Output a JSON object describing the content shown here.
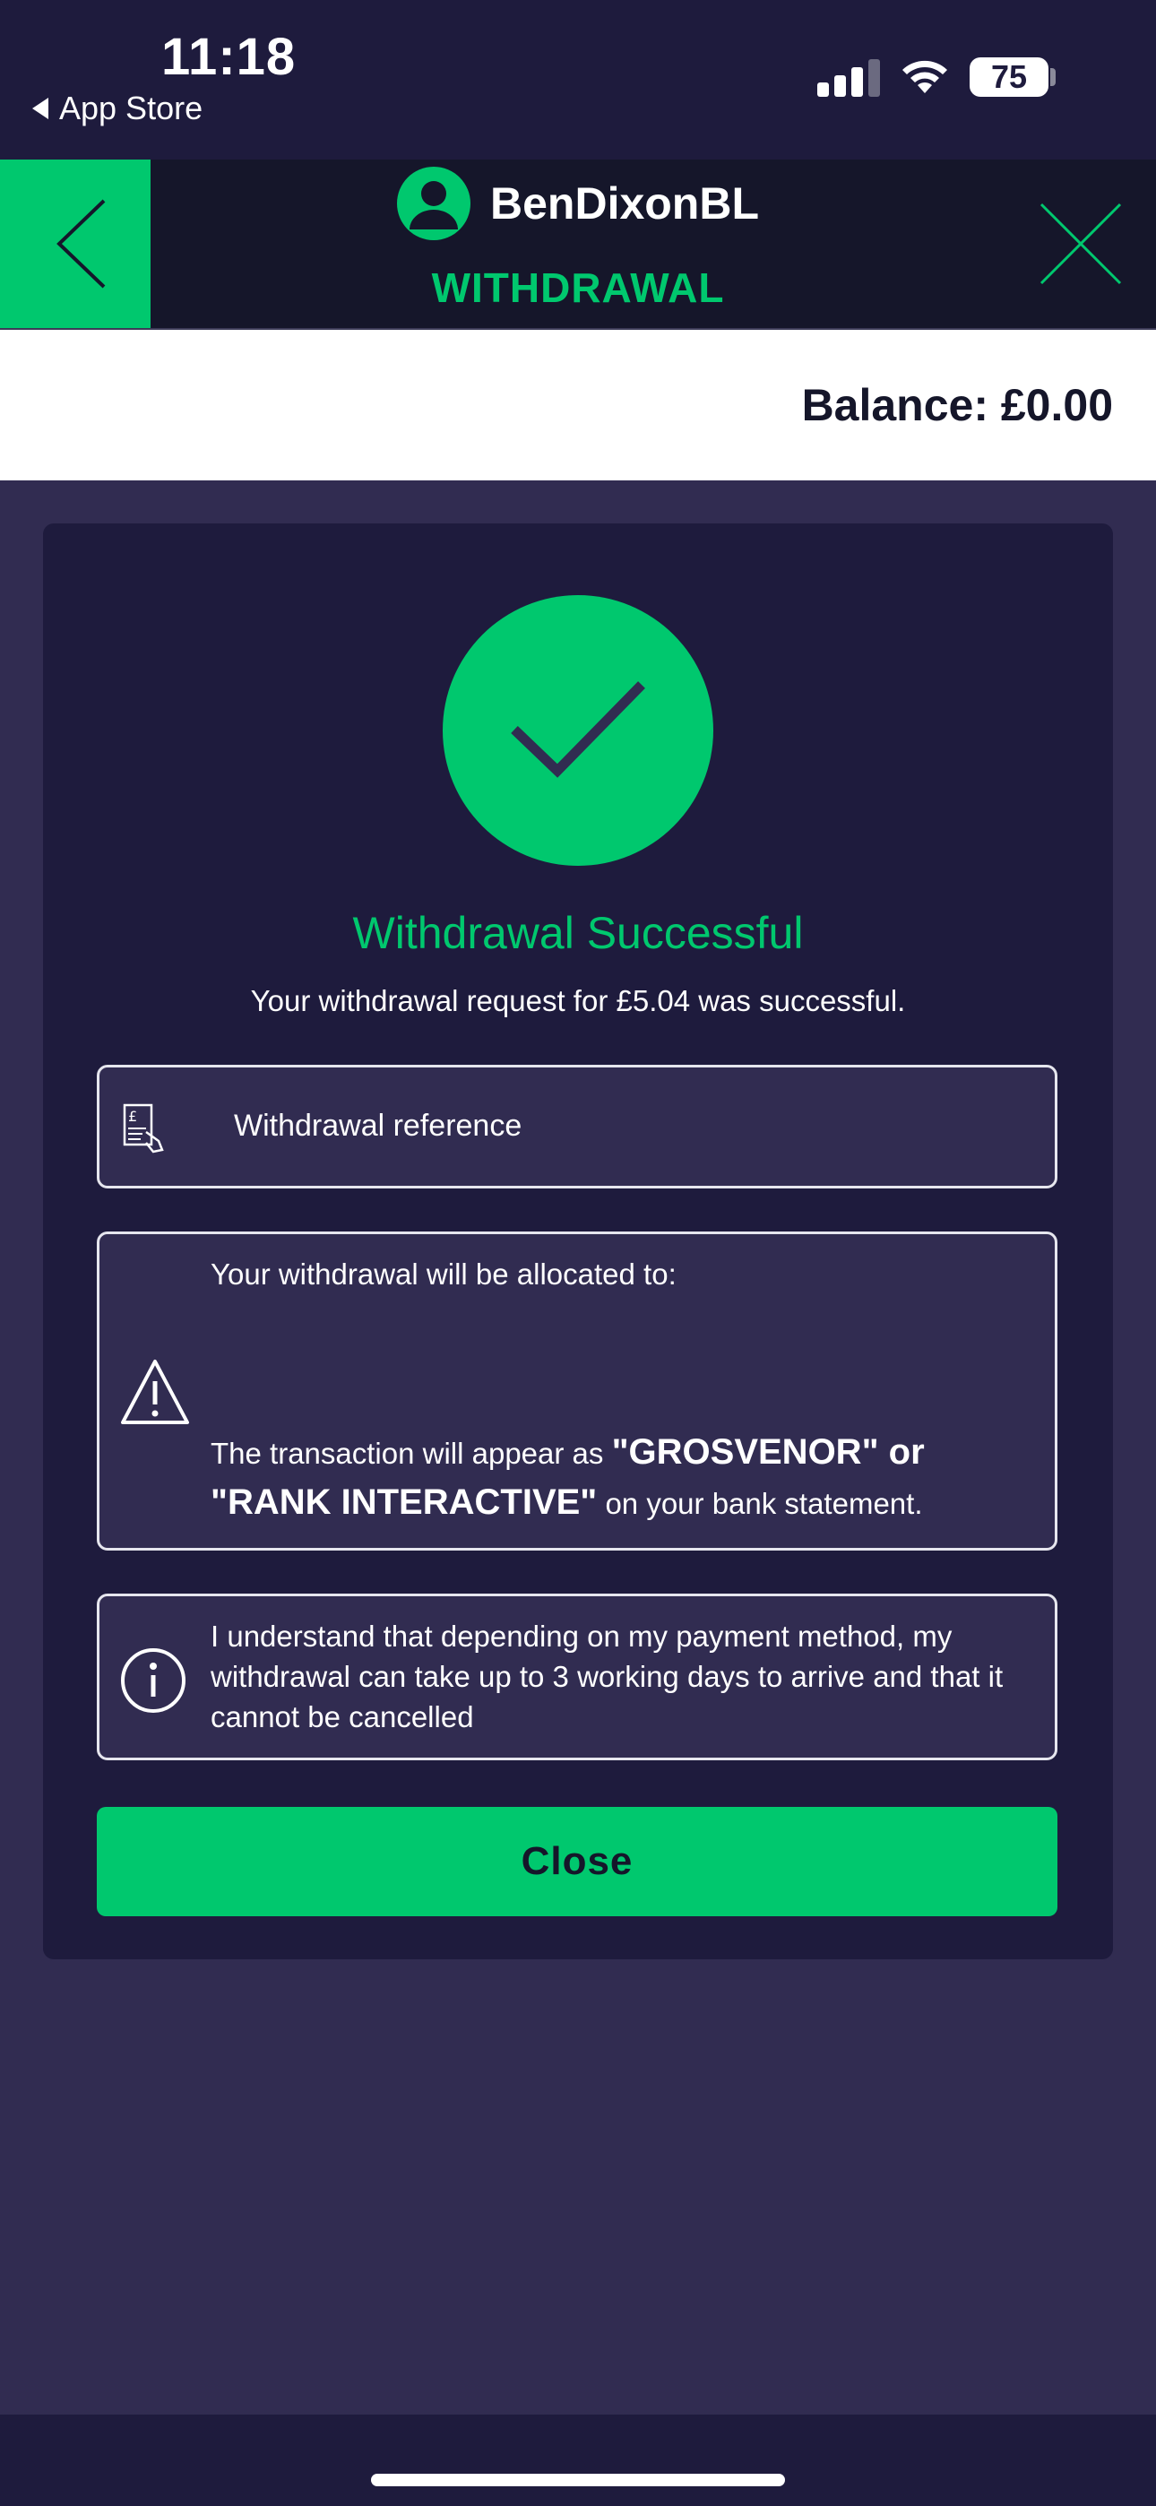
{
  "status_bar": {
    "time": "11:18",
    "back_app_label": "App Store",
    "battery_level": "75"
  },
  "header": {
    "username": "BenDixonBL",
    "title": "WITHDRAWAL"
  },
  "balance": {
    "label": "Balance: £0.00"
  },
  "result": {
    "title": "Withdrawal Successful",
    "message": "Your withdrawal request for £5.04 was successful."
  },
  "reference": {
    "label": "Withdrawal reference"
  },
  "allocation": {
    "line1": "Your withdrawal will be allocated to:",
    "line2_prefix": "The transaction will appear as ",
    "line2_bold": "\"GROSVENOR\" or \"RANK INTERACTIVE\"",
    "line2_suffix": " on your bank statement."
  },
  "info": {
    "text": "I understand that depending on my payment method, my withdrawal can take up to 3 working days to arrive and that it cannot be cancelled"
  },
  "close_button": {
    "label": "Close"
  },
  "colors": {
    "accent": "#00c86e",
    "background": "#312c51",
    "card": "#1e1b3d",
    "header": "#15162a"
  }
}
